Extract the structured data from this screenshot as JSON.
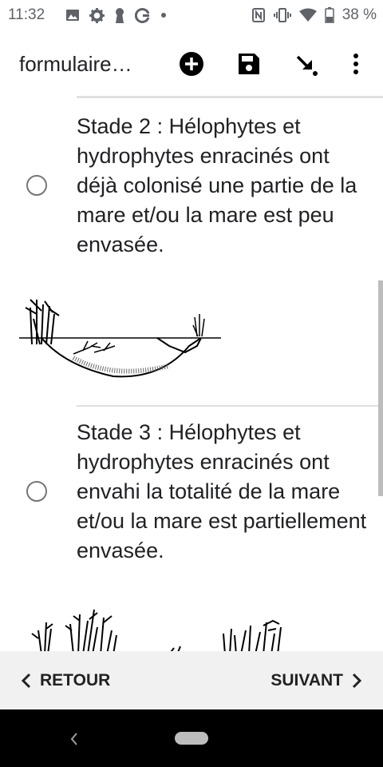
{
  "status_bar": {
    "time": "11:32",
    "left_icons": [
      "image-icon",
      "gear-icon",
      "keyhole-icon",
      "google-g-icon",
      "dot-icon"
    ],
    "right_icons": [
      "nfc-icon",
      "vibrate-icon",
      "wifi-icon",
      "battery-icon"
    ],
    "battery": "38 %"
  },
  "app_bar": {
    "title": "formulaire…",
    "actions": [
      "add-icon",
      "save-icon",
      "arrow-down-right-icon",
      "more-vertical-icon"
    ]
  },
  "options": [
    {
      "label": "Stade 2 : Hélophytes et hydrophytes enracinés ont déjà colonisé une partie de la mare et/ou la mare est peu envasée.",
      "selected": false
    },
    {
      "label": "Stade 3 : Hélophytes et hydrophytes enracinés ont envahi la totalité de la mare et/ou la mare est partiellement envasée.",
      "selected": false
    }
  ],
  "bottom_nav": {
    "back_label": "RETOUR",
    "next_label": "SUIVANT"
  },
  "colors": {
    "text": "#202124",
    "radio": "#757575",
    "bottom_bar": "#f1f1f1"
  }
}
